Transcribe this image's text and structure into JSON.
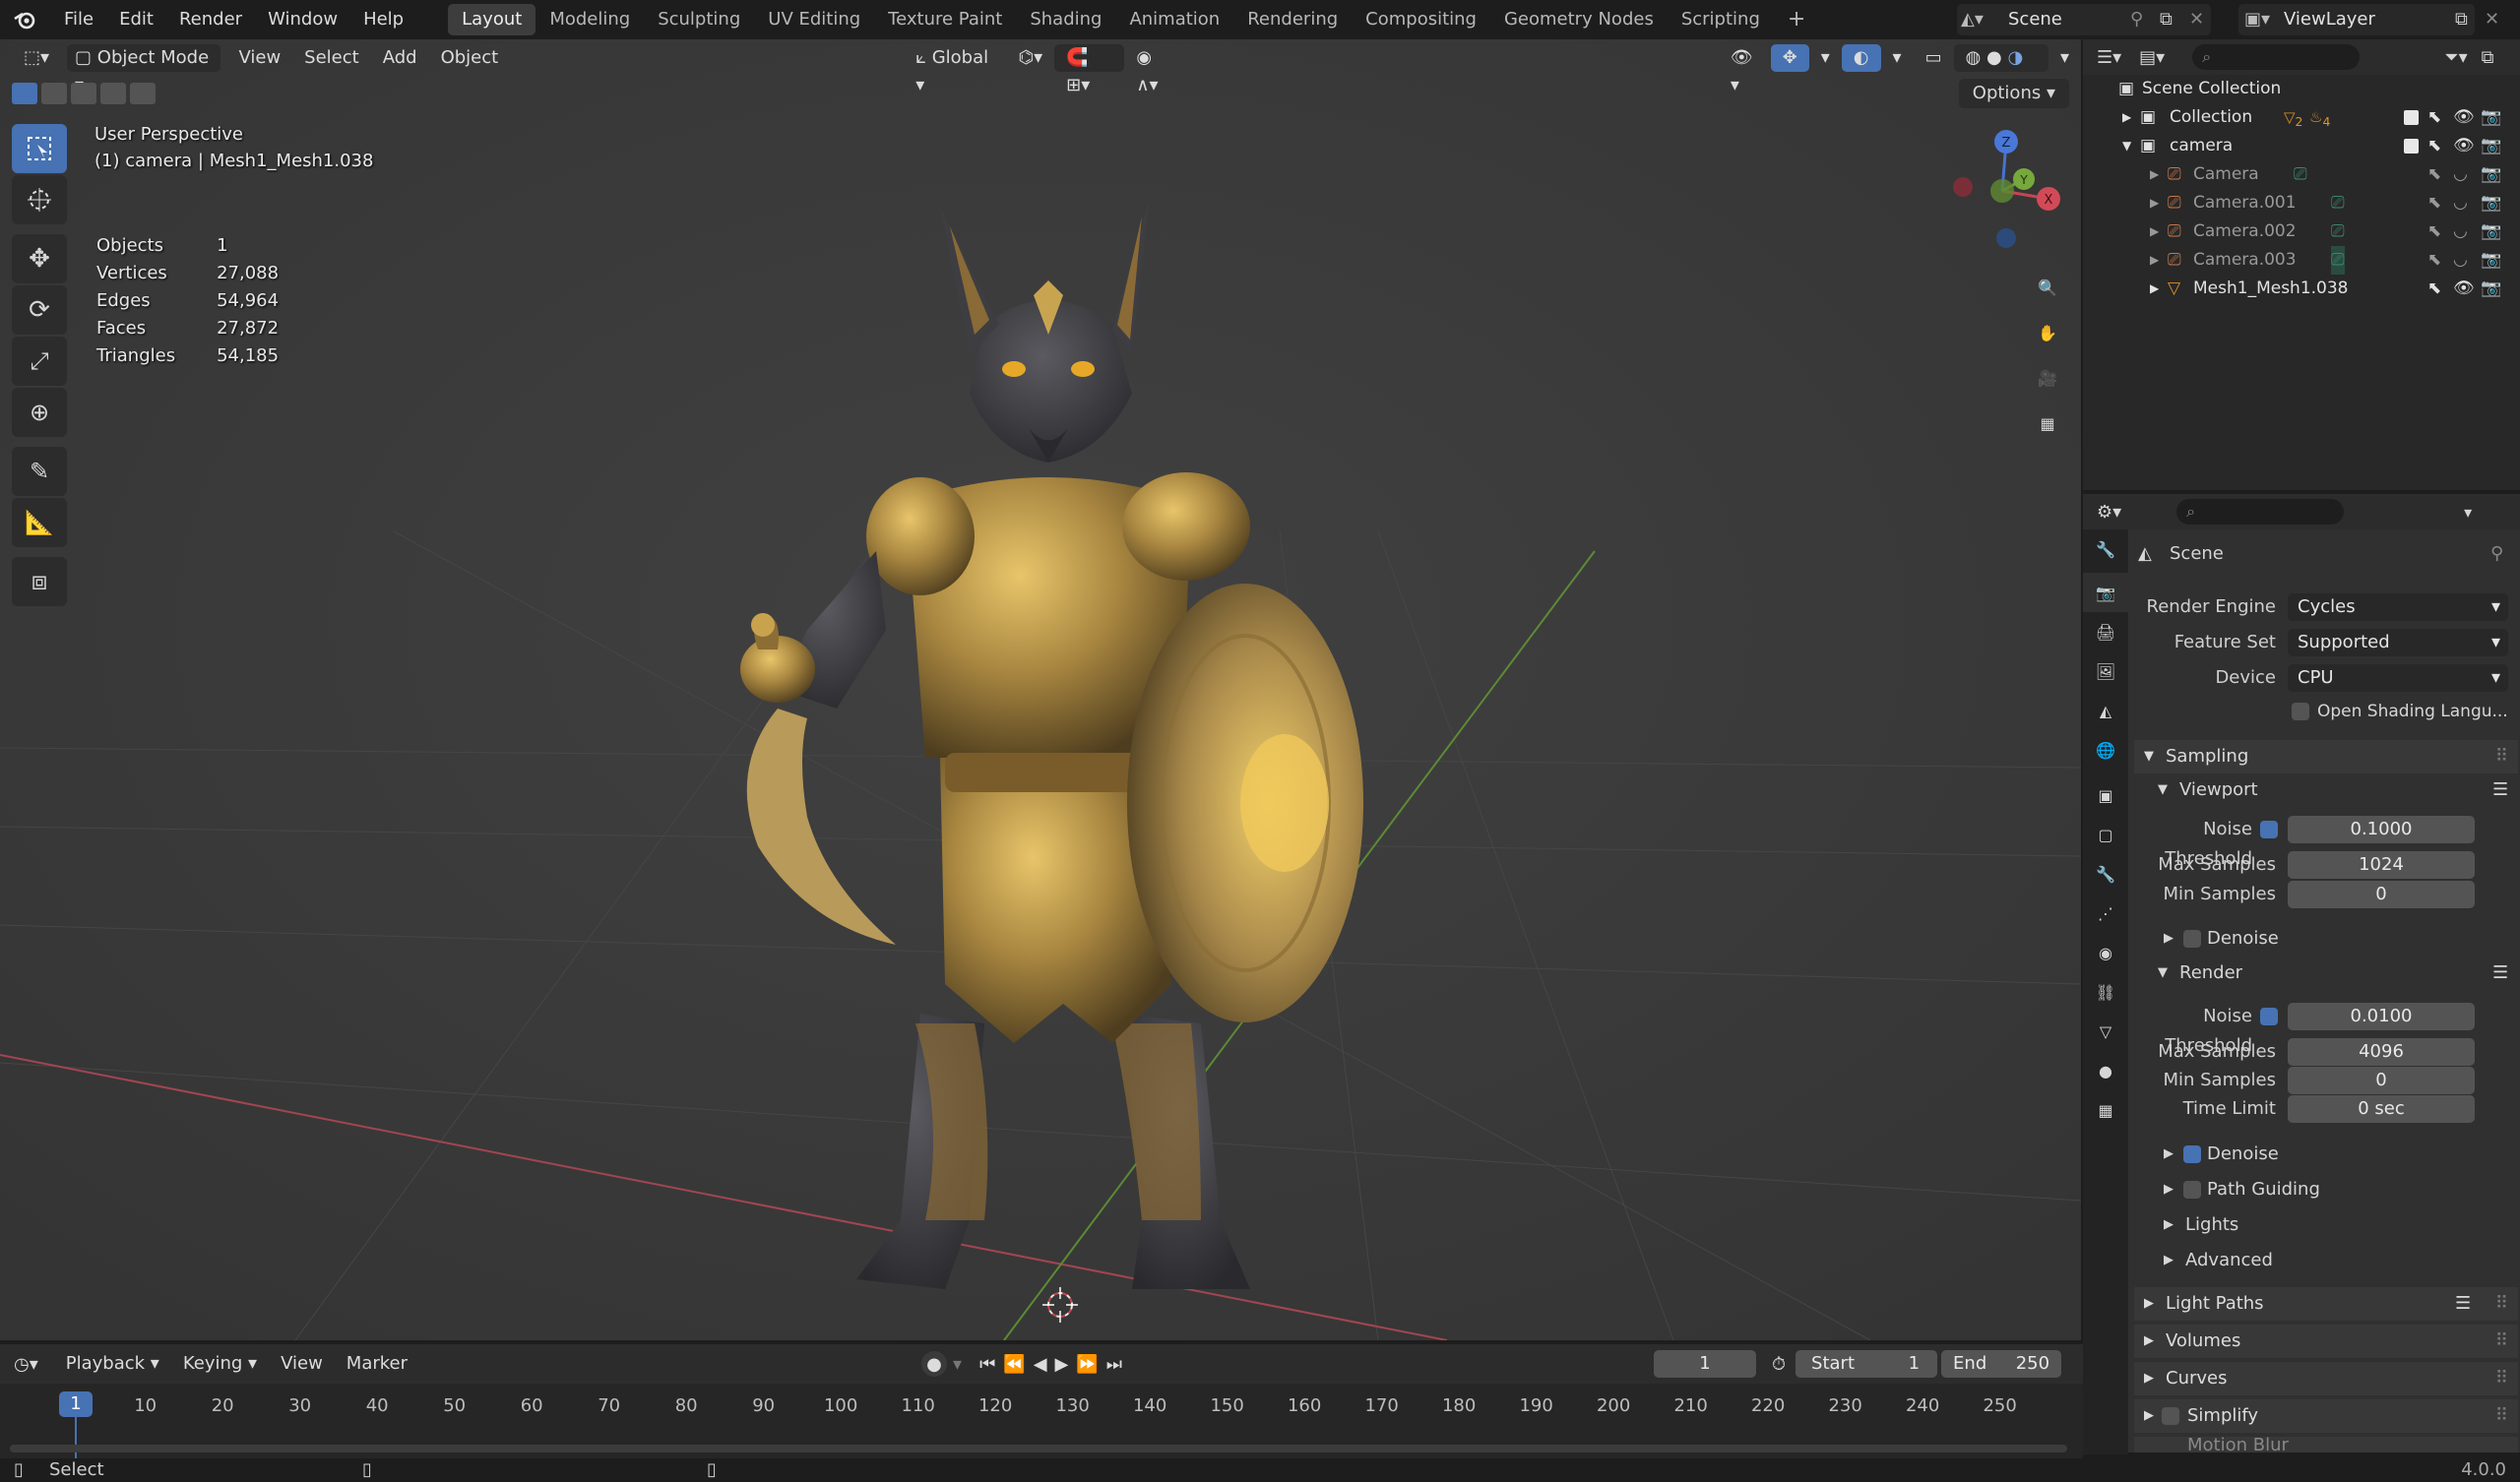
{
  "app": {
    "menus": [
      "File",
      "Edit",
      "Render",
      "Window",
      "Help"
    ],
    "workspaces": [
      "Layout",
      "Modeling",
      "Sculpting",
      "UV Editing",
      "Texture Paint",
      "Shading",
      "Animation",
      "Rendering",
      "Compositing",
      "Geometry Nodes",
      "Scripting"
    ],
    "active_workspace": "Layout",
    "scene": "Scene",
    "view_layer": "ViewLayer"
  },
  "viewport": {
    "mode": "Object Mode",
    "menus": [
      "View",
      "Select",
      "Add",
      "Object"
    ],
    "transform_orientation": "Global",
    "options_label": "Options",
    "view_name": "User Perspective",
    "object_info": "(1) camera | Mesh1_Mesh1.038",
    "stats": [
      {
        "label": "Objects",
        "value": "1"
      },
      {
        "label": "Vertices",
        "value": "27,088"
      },
      {
        "label": "Edges",
        "value": "54,964"
      },
      {
        "label": "Faces",
        "value": "27,872"
      },
      {
        "label": "Triangles",
        "value": "54,185"
      }
    ],
    "gizmo": {
      "z": "Z",
      "y": "Y",
      "x": "X"
    }
  },
  "outliner": {
    "root": "Scene Collection",
    "rows": [
      {
        "name": "Collection",
        "level": 1,
        "expanded": false
      },
      {
        "name": "camera",
        "level": 1,
        "expanded": true
      },
      {
        "name": "Camera",
        "level": 2,
        "expanded": false
      },
      {
        "name": "Camera.001",
        "level": 2,
        "expanded": false
      },
      {
        "name": "Camera.002",
        "level": 2,
        "expanded": false
      },
      {
        "name": "Camera.003",
        "level": 2,
        "expanded": false
      },
      {
        "name": "Mesh1_Mesh1.038",
        "level": 2,
        "expanded": false
      }
    ],
    "collection_badges": [
      "2",
      "4"
    ]
  },
  "properties": {
    "context": "Scene",
    "render_engine_label": "Render Engine",
    "render_engine": "Cycles",
    "feature_set_label": "Feature Set",
    "feature_set": "Supported",
    "device_label": "Device",
    "device": "CPU",
    "osl_label": "Open Shading Langu...",
    "sampling": "Sampling",
    "viewport_sub": "Viewport",
    "render_sub": "Render",
    "noise_threshold_label": "Noise Threshold",
    "max_samples_label": "Max Samples",
    "min_samples_label": "Min Samples",
    "time_limit_label": "Time Limit",
    "denoise_label": "Denoise",
    "path_guiding_label": "Path Guiding",
    "lights_label": "Lights",
    "advanced_label": "Advanced",
    "vp_noise": "0.1000",
    "vp_max": "1024",
    "vp_min": "0",
    "r_noise": "0.0100",
    "r_max": "4096",
    "r_min": "0",
    "r_time": "0 sec",
    "light_paths": "Light Paths",
    "volumes": "Volumes",
    "curves": "Curves",
    "simplify": "Simplify",
    "motion_blur": "Motion Blur"
  },
  "timeline": {
    "menus": [
      "Playback",
      "Keying",
      "View",
      "Marker"
    ],
    "current_frame": "1",
    "start_label": "Start",
    "start": "1",
    "end_label": "End",
    "end": "250",
    "ticks": [
      "10",
      "20",
      "30",
      "40",
      "50",
      "60",
      "70",
      "80",
      "90",
      "100",
      "110",
      "120",
      "130",
      "140",
      "150",
      "160",
      "170",
      "180",
      "190",
      "200",
      "210",
      "220",
      "230",
      "240",
      "250"
    ]
  },
  "status": {
    "left": "Select",
    "version": "4.0.0"
  },
  "colors": {
    "accent": "#4772b3",
    "viewport": "#3a3a3a",
    "axis_x": "#c0424e",
    "axis_y": "#6a9a3a"
  }
}
